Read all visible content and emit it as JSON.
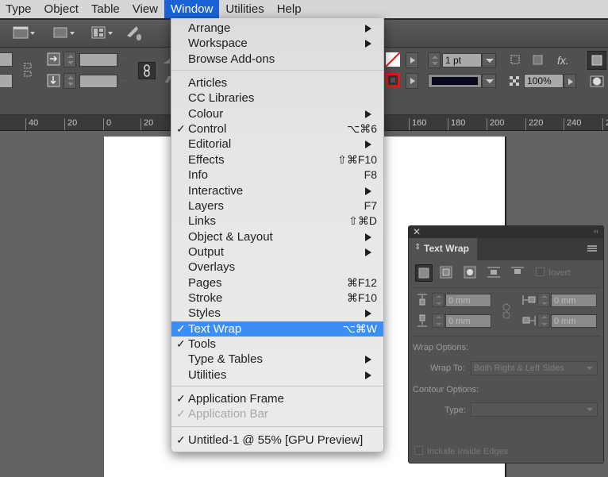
{
  "menubar": {
    "items": [
      "Type",
      "Object",
      "Table",
      "View",
      "Window",
      "Utilities",
      "Help"
    ],
    "active": "Window"
  },
  "control_panel": {
    "stroke_weight": "1 pt",
    "opacity": "100%",
    "fx_label": "fx.",
    "stroke_color": "#0a0a1e",
    "stroke_swatch_color": "#e8141e"
  },
  "ruler": {
    "ticks": [
      "40",
      "20",
      "0",
      "20",
      "160",
      "180",
      "200",
      "220",
      "240",
      "2"
    ]
  },
  "window_menu": {
    "groups": [
      [
        {
          "label": "Arrange",
          "submenu": true
        },
        {
          "label": "Workspace",
          "submenu": true
        },
        {
          "label": "Browse Add-ons"
        }
      ],
      [
        {
          "label": "Articles"
        },
        {
          "label": "CC Libraries"
        },
        {
          "label": "Colour",
          "submenu": true
        },
        {
          "label": "Control",
          "checked": true,
          "shortcut": "⌥⌘6"
        },
        {
          "label": "Editorial",
          "submenu": true
        },
        {
          "label": "Effects",
          "shortcut": "⇧⌘F10"
        },
        {
          "label": "Info",
          "shortcut": "F8"
        },
        {
          "label": "Interactive",
          "submenu": true
        },
        {
          "label": "Layers",
          "shortcut": "F7"
        },
        {
          "label": "Links",
          "shortcut": "⇧⌘D"
        },
        {
          "label": "Object & Layout",
          "submenu": true
        },
        {
          "label": "Output",
          "submenu": true
        },
        {
          "label": "Overlays"
        },
        {
          "label": "Pages",
          "shortcut": "⌘F12"
        },
        {
          "label": "Stroke",
          "shortcut": "⌘F10"
        },
        {
          "label": "Styles",
          "submenu": true
        },
        {
          "label": "Text Wrap",
          "checked": true,
          "shortcut": "⌥⌘W",
          "highlighted": true
        },
        {
          "label": "Tools",
          "checked": true
        },
        {
          "label": "Type & Tables",
          "submenu": true
        },
        {
          "label": "Utilities",
          "submenu": true
        }
      ],
      [
        {
          "label": "Application Frame",
          "checked": true
        },
        {
          "label": "Application Bar",
          "checked": true,
          "disabled": true
        }
      ],
      [
        {
          "label": "Untitled-1 @ 55% [GPU Preview]",
          "checked": true
        }
      ]
    ]
  },
  "text_wrap_panel": {
    "title": "Text Wrap",
    "invert_label": "Invert",
    "top_offset": "0 mm",
    "bottom_offset": "0 mm",
    "left_offset": "0 mm",
    "right_offset": "0 mm",
    "wrap_options_label": "Wrap Options:",
    "wrap_to_label": "Wrap To:",
    "wrap_to_value": "Both Right & Left Sides",
    "contour_options_label": "Contour Options:",
    "type_label": "Type:",
    "type_value": "",
    "include_inside_edges_label": "Include Inside Edges"
  }
}
